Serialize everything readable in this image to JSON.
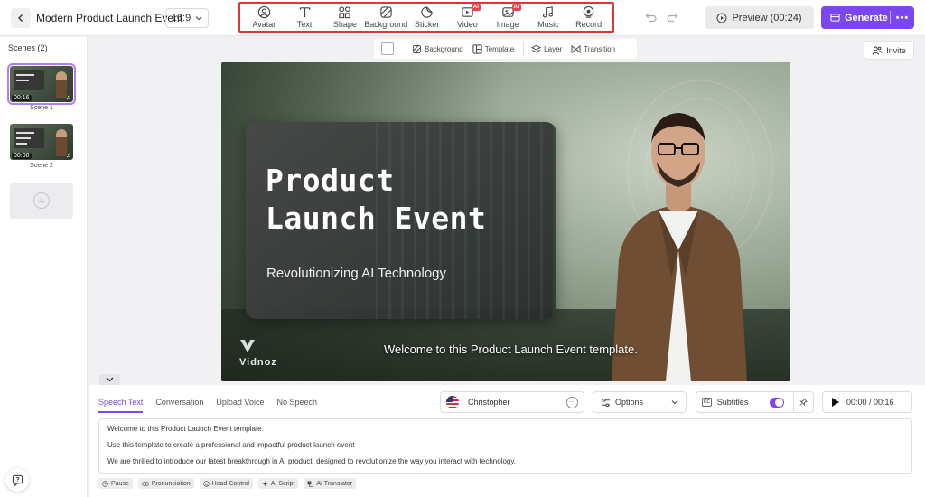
{
  "header": {
    "project_title": "Modern Product Launch Event",
    "aspect_ratio": "16:9",
    "tools": [
      {
        "label": "Avatar",
        "icon": "avatar-icon"
      },
      {
        "label": "Text",
        "icon": "text-icon"
      },
      {
        "label": "Shape",
        "icon": "shape-icon"
      },
      {
        "label": "Background",
        "icon": "background-icon"
      },
      {
        "label": "Sticker",
        "icon": "sticker-icon"
      },
      {
        "label": "Video",
        "icon": "video-icon",
        "badge": "AI"
      },
      {
        "label": "Image",
        "icon": "image-icon",
        "badge": "AI"
      },
      {
        "label": "Music",
        "icon": "music-icon"
      },
      {
        "label": "Record",
        "icon": "record-icon"
      }
    ],
    "preview_label": "Preview (00:24)",
    "generate_label": "Generate",
    "generate_more": "•••"
  },
  "scenes": {
    "title": "Scenes (2)",
    "items": [
      {
        "label": "Scene 1",
        "duration": "00:16",
        "active": true
      },
      {
        "label": "Scene 2",
        "duration": "00:08",
        "active": false
      }
    ],
    "add_symbol": "+"
  },
  "canvas_toolbar": {
    "background": "Background",
    "template": "Template",
    "layer": "Layer",
    "transition": "Transition"
  },
  "invite_label": "Invite",
  "canvas": {
    "title_line1": "Product",
    "title_line2": "Launch Event",
    "subtitle": "Revolutionizing AI Technology",
    "caption": "Welcome to this Product Launch Event template.",
    "watermark": "Vidnoz"
  },
  "speech_panel": {
    "tabs": [
      {
        "label": "Speech Text",
        "active": true
      },
      {
        "label": "Conversation",
        "active": false
      },
      {
        "label": "Upload Voice",
        "active": false
      },
      {
        "label": "No Speech",
        "active": false
      }
    ],
    "voice": "Christopher",
    "voice_more": "···",
    "options_label": "Options",
    "subtitles_label": "Subtitles",
    "subtitles_on": true,
    "cc_text": "CC",
    "time": "00:00 / 00:16",
    "script_lines": [
      "Welcome to this Product Launch Event template.",
      "Use this template to create a professional and impactful product launch event",
      "We are thrilled to introduce our latest breakthrough in AI product, designed to revolutionize the way you interact with technology."
    ],
    "bottom_tools": [
      "Pause",
      "Pronunciation",
      "Head Control",
      "AI Script",
      "AI Translator"
    ]
  },
  "colors": {
    "accent": "#7b45f0",
    "highlight_border": "#e03535",
    "ai_badge": "#e8434f"
  }
}
